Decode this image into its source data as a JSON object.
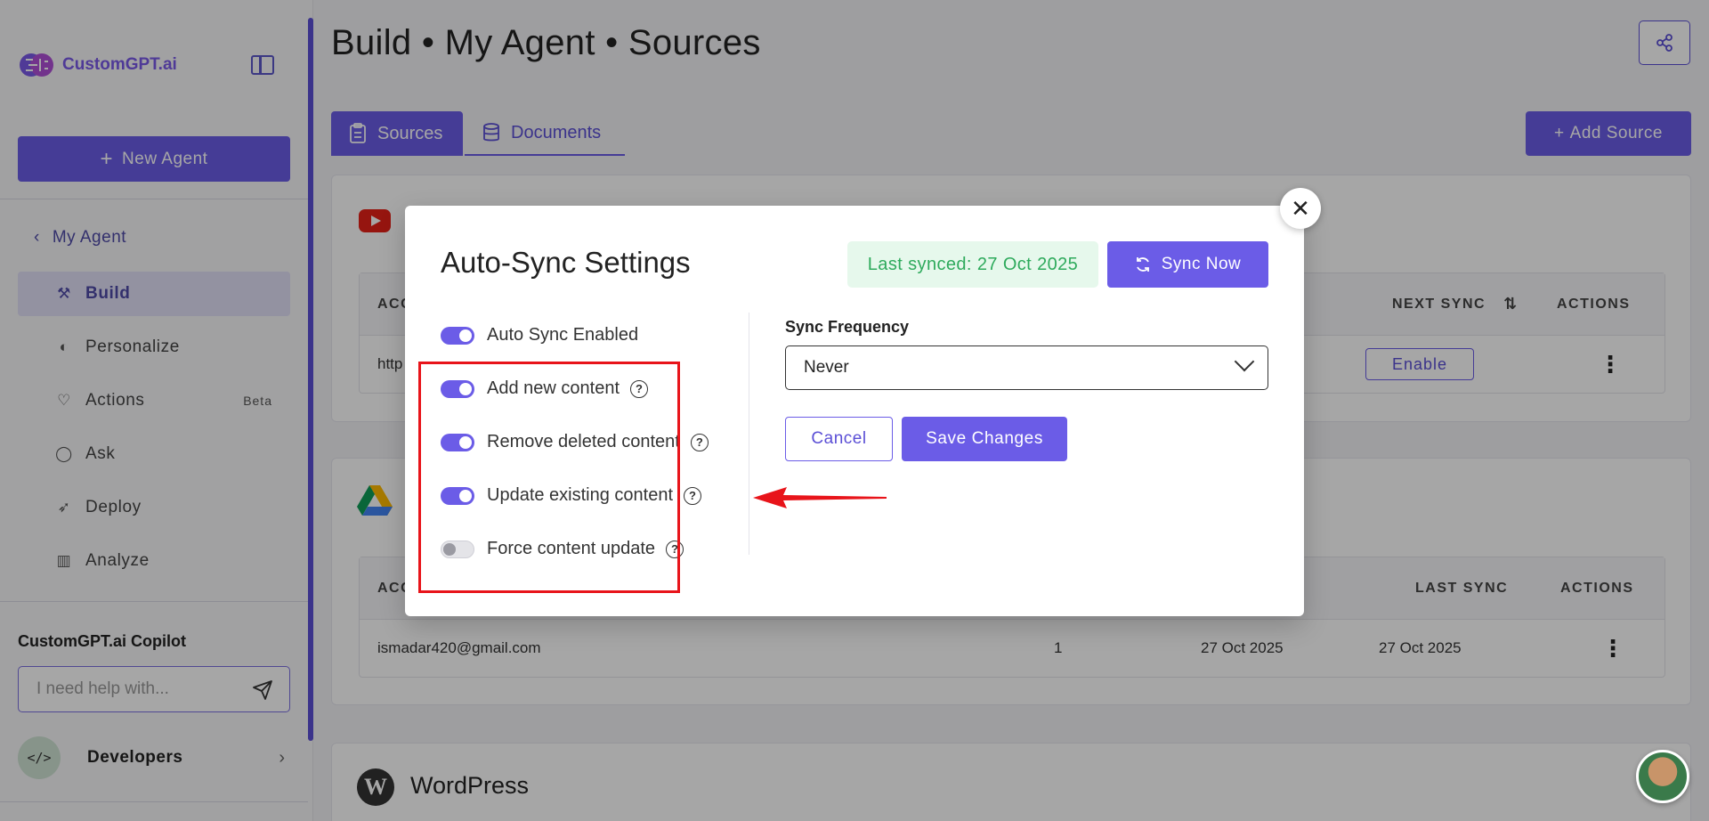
{
  "brand": {
    "name": "CustomGPT.ai"
  },
  "sidebar": {
    "new_agent_label": "New Agent",
    "back_label": "My Agent",
    "items": [
      {
        "label": "Build",
        "icon": "build-icon",
        "active": true,
        "badge": ""
      },
      {
        "label": "Personalize",
        "icon": "palette-icon",
        "active": false,
        "badge": ""
      },
      {
        "label": "Actions",
        "icon": "heart-handshake-icon",
        "active": false,
        "badge": "Beta"
      },
      {
        "label": "Ask",
        "icon": "chat-bubble-icon",
        "active": false,
        "badge": ""
      },
      {
        "label": "Deploy",
        "icon": "rocket-icon",
        "active": false,
        "badge": ""
      },
      {
        "label": "Analyze",
        "icon": "bar-chart-icon",
        "active": false,
        "badge": ""
      }
    ],
    "copilot": {
      "title": "CustomGPT.ai Copilot",
      "placeholder": "I need help with..."
    },
    "developers_label": "Developers"
  },
  "header": {
    "title": "Build • My Agent • Sources"
  },
  "tabs": [
    {
      "label": "Sources",
      "icon": "clipboard-icon",
      "active": true
    },
    {
      "label": "Documents",
      "icon": "database-icon",
      "active": false
    }
  ],
  "add_source_label": "Add Source",
  "youtube_card": {
    "icon": "youtube-icon",
    "headers": {
      "account": "ACC",
      "next_sync": "NEXT SYNC",
      "actions": "ACTIONS"
    },
    "row": {
      "account": "http",
      "next_sync_button": "Enable"
    }
  },
  "drive_card": {
    "icon": "google-drive-icon",
    "headers": {
      "account": "ACC",
      "last_sync": "LAST SYNC",
      "actions": "ACTIONS"
    },
    "row": {
      "account": "ismadar420@gmail.com",
      "count": "1",
      "date": "27 Oct 2025",
      "last_sync": "27 Oct 2025"
    }
  },
  "wordpress_card": {
    "icon": "wordpress-icon",
    "title": "WordPress"
  },
  "modal": {
    "title": "Auto-Sync Settings",
    "last_synced": "Last synced: 27 Oct 2025",
    "sync_now_label": "Sync Now",
    "toggles": [
      {
        "label": "Auto Sync Enabled",
        "on": true,
        "help": false
      },
      {
        "label": "Add new content",
        "on": true,
        "help": true
      },
      {
        "label": "Remove deleted content",
        "on": true,
        "help": true
      },
      {
        "label": "Update existing content",
        "on": true,
        "help": true
      },
      {
        "label": "Force content update",
        "on": false,
        "help": true
      }
    ],
    "frequency_label": "Sync Frequency",
    "frequency_value": "Never",
    "cancel_label": "Cancel",
    "save_label": "Save Changes"
  },
  "colors": {
    "accent": "#6b5ce7",
    "annotation_red": "#e8141a",
    "synced_green": "#2eaa5c"
  }
}
